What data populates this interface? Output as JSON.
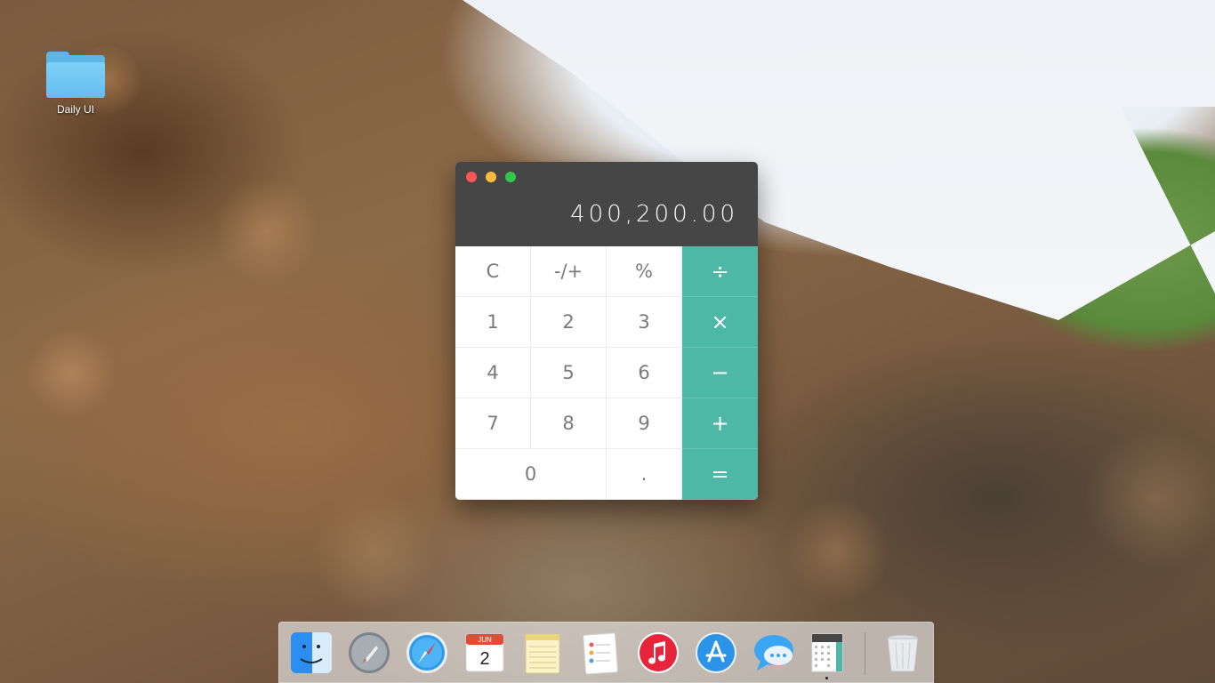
{
  "desktop": {
    "icons": [
      {
        "label": "Daily UI",
        "icon": "folder-icon"
      }
    ]
  },
  "calculator": {
    "display": "400,200.00",
    "rows": [
      [
        "C",
        "-/+",
        "%",
        "÷"
      ],
      [
        "1",
        "2",
        "3",
        "×"
      ],
      [
        "4",
        "5",
        "6",
        "−"
      ],
      [
        "7",
        "8",
        "9",
        "+"
      ],
      [
        "0",
        ".",
        "="
      ]
    ],
    "accent_color": "#4db8a5",
    "titlebar_color": "#464646"
  },
  "dock": {
    "apps": [
      {
        "name": "finder-icon"
      },
      {
        "name": "launchpad-icon"
      },
      {
        "name": "safari-icon"
      },
      {
        "name": "calendar-icon",
        "month": "JUN",
        "day": "2"
      },
      {
        "name": "notes-icon"
      },
      {
        "name": "reminders-icon"
      },
      {
        "name": "itunes-icon"
      },
      {
        "name": "app-store-icon"
      },
      {
        "name": "messages-icon"
      },
      {
        "name": "calculator-icon",
        "running": true
      },
      {
        "name": "trash-icon"
      }
    ]
  }
}
